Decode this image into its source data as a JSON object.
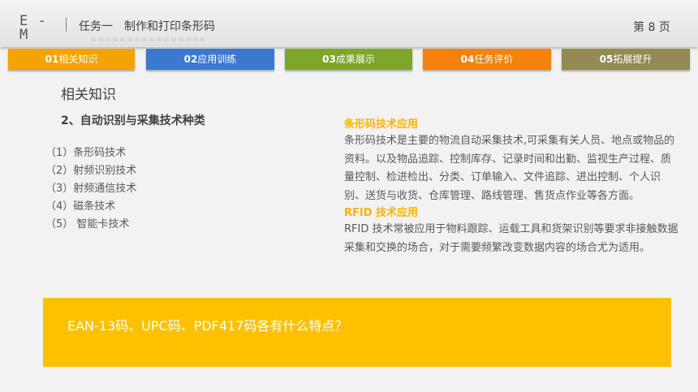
{
  "header": {
    "logo_line1": "E -",
    "logo_line2": "M",
    "task_label": "任务一",
    "task_title": "制作和打印条形码",
    "page_number": "第 8 页"
  },
  "tabs": [
    {
      "num": "01",
      "label": "相关知识",
      "color": "#f5a300"
    },
    {
      "num": "02",
      "label": "应用训练",
      "color": "#3c78d0"
    },
    {
      "num": "03",
      "label": "成果展示",
      "color": "#7ea62a"
    },
    {
      "num": "04",
      "label": "任务评价",
      "color": "#f5820a"
    },
    {
      "num": "05",
      "label": "拓展提升",
      "color": "#948a54"
    }
  ],
  "main": {
    "section_heading": "相关知识",
    "subsection_heading": "2、自动识别与采集技术种类",
    "tech_list": [
      "（1）条形码技术",
      "（2）射频识别技术",
      "（3）射频通信技术",
      "（4）磁条技术",
      "（5） 智能卡技术"
    ],
    "barcode": {
      "title": "条形码技术应用",
      "body": "条形码技术是主要的物流自动采集技术,可采集有关人员、地点或物品的资料。以及物品追踪、控制库存、记录时间和出勤、监视生产过程、质量控制、检进检出、分类、订单输入、文件追踪、进出控制、个人识别、送货与收货、仓库管理、路线管理、售货点作业等各方面。"
    },
    "rfid": {
      "title": "RFID 技术应用",
      "body": "RFID 技术常被应用于物料跟踪、运载工具和货架识别等要求非接触数据采集和交换的场合，对于需要频繁改变数据内容的场合尤为适用。"
    },
    "callout_question": "EAN-13码、UPC码、PDF417码各有什么特点？"
  }
}
